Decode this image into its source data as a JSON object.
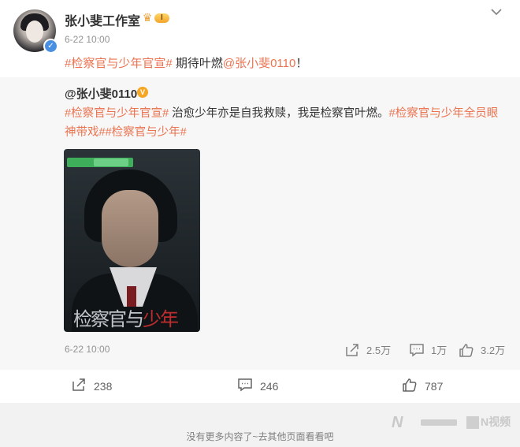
{
  "post": {
    "username": "张小斐工作室",
    "level": "I",
    "time": "6-22 10:00",
    "text_hashtag": "#检察官与少年官宣#",
    "text_middle": " 期待叶燃",
    "text_mention": "@张小斐0110",
    "text_end": "！"
  },
  "retweet": {
    "author": "@张小斐0110",
    "text_hashtag1": "#检察官与少年官宣#",
    "text_body": " 治愈少年亦是自我救赎，我是检察官叶燃。",
    "text_hashtag2": "#检察官与少年全员眼神带戏#",
    "text_hashtag3": "#检察官与少年#",
    "poster_title_part1": "检察官与",
    "poster_title_part2": "少年",
    "time": "6-22 10:00",
    "shares": "2.5万",
    "comments": "1万",
    "likes": "3.2万"
  },
  "actions": {
    "shares": "238",
    "comments": "246",
    "likes": "787"
  },
  "footer": {
    "text": "没有更多内容了~去其他页面看看吧",
    "watermark1": "N",
    "watermark2": "N视频"
  },
  "colors": {
    "accent": "#eb7350",
    "verified": "#4a90e2",
    "retweet_bg": "#f7f7f7",
    "footer_bg": "#f2f2f2"
  }
}
